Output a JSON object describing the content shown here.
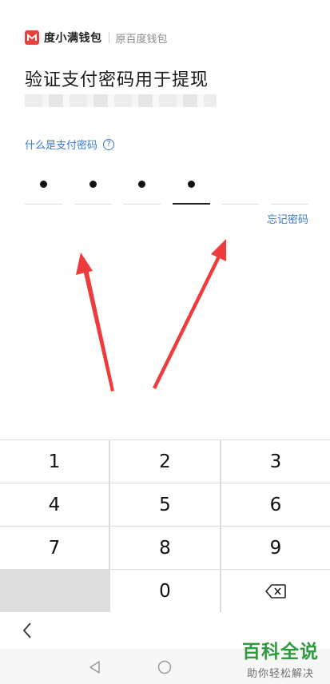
{
  "header": {
    "brand_name": "度小满钱包",
    "brand_sub": "原百度钱包",
    "title": "验证支付密码用于提现"
  },
  "help": {
    "label": "什么是支付密码",
    "icon": "?"
  },
  "pin": {
    "length": 6,
    "filled": 4
  },
  "forgot_label": "忘记密码",
  "keypad": {
    "keys": [
      "1",
      "2",
      "3",
      "4",
      "5",
      "6",
      "7",
      "8",
      "9",
      "",
      "0",
      "backspace"
    ]
  },
  "colors": {
    "accent": "#3a78d6",
    "brand": "#e8423f",
    "annotation_arrow": "#ee3b3b",
    "watermark": "#2f9b3d"
  },
  "watermark": {
    "main": "百科全说",
    "sub": "助你轻松解决"
  }
}
